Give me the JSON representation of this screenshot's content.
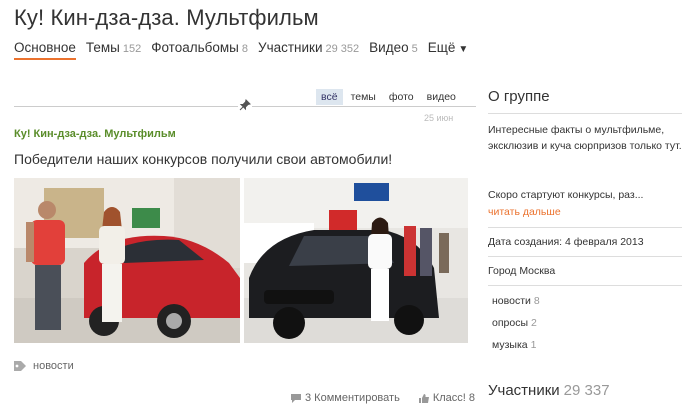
{
  "header": {
    "title": "Ку! Кин-дза-дза. Мультфильм"
  },
  "nav": {
    "items": [
      {
        "label": "Основное",
        "count": ""
      },
      {
        "label": "Темы",
        "count": "152"
      },
      {
        "label": "Фотоальбомы",
        "count": "8"
      },
      {
        "label": "Участники",
        "count": "29 352"
      },
      {
        "label": "Видео",
        "count": "5"
      }
    ],
    "more_label": "Ещё"
  },
  "feed": {
    "filters": [
      "всё",
      "темы",
      "фото",
      "видео"
    ],
    "post": {
      "time": "25 июн",
      "group": "Ку! Кин-дза-дза. Мультфильм",
      "text": "Победители наших конкурсов получили свои автомобили!",
      "tag": "новости",
      "comments_label": "3 Комментировать",
      "like_label": "Класс! 8"
    }
  },
  "sidebar": {
    "title": "О группе",
    "description": "Интересные факты о мультфильме, эксклюзив и куча сюрпризов только тут.",
    "soon_text": "Скоро стартуют конкурсы, раз...",
    "read_more": "читать дальше",
    "created": "Дата создания: 4 февраля 2013",
    "city": "Город Москва",
    "categories": [
      {
        "label": "новости",
        "count": "8"
      },
      {
        "label": "опросы",
        "count": "2"
      },
      {
        "label": "музыка",
        "count": "1"
      }
    ],
    "members_label": "Участники",
    "members_count": "29 337"
  },
  "colors": {
    "accent": "#eb722e",
    "group_link": "#5a8d2a",
    "filter_active": "#dde6ef"
  }
}
